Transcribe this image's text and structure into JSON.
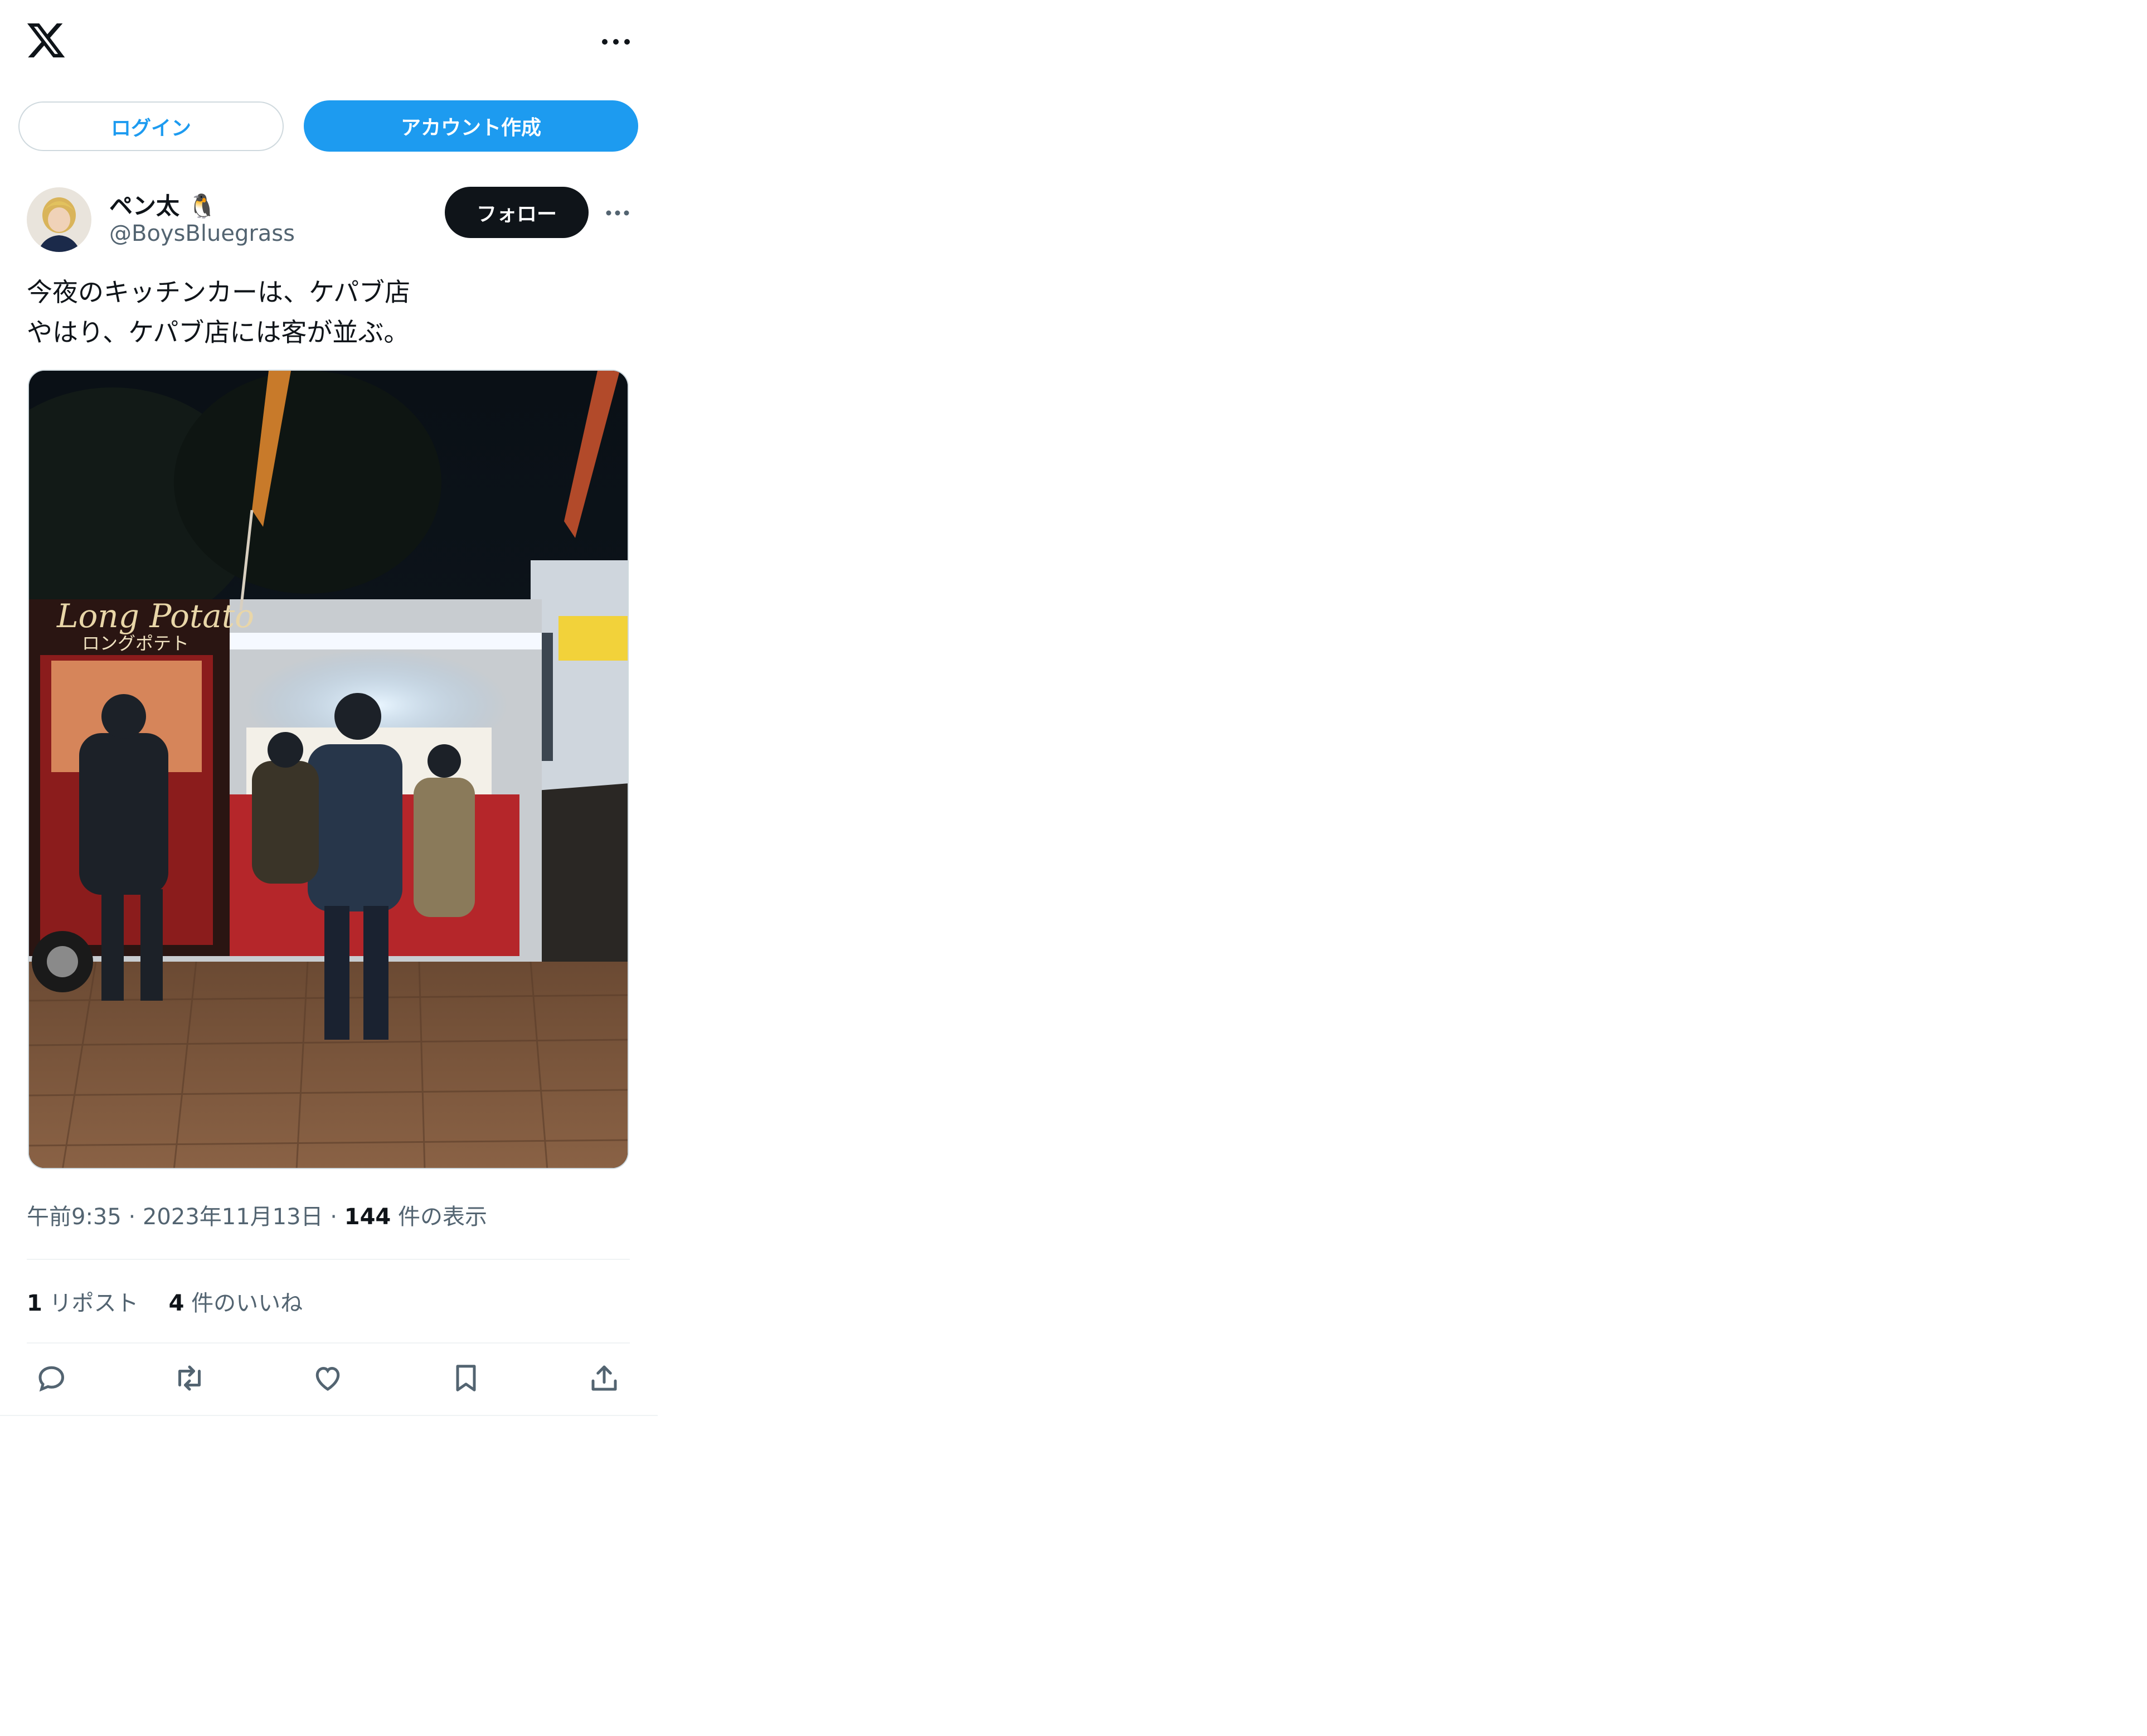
{
  "header": {
    "logo_icon": "x-logo-icon",
    "more_icon": "more-horizontal-icon"
  },
  "auth": {
    "login_label": "ログイン",
    "signup_label": "アカウント作成"
  },
  "author": {
    "name": "ペン太 🐧",
    "handle": "@BoysBluegrass",
    "follow_label": "フォロー"
  },
  "tweet": {
    "text": "今夜のキッチンカーは、ケパブ店\nやはり、ケパブ店には客が並ぶ。",
    "media_sign_en": "Long Potato",
    "media_sign_jp": "ロングポテト"
  },
  "meta": {
    "time": "午前9:35",
    "date": "2023年11月13日",
    "views_count": "144",
    "views_label": "件の表示"
  },
  "stats": {
    "reposts_count": "1",
    "reposts_label": "リポスト",
    "likes_count": "4",
    "likes_label": "件のいいね"
  },
  "actions": [
    "reply-icon",
    "repost-icon",
    "like-icon",
    "bookmark-icon",
    "share-icon"
  ],
  "colors": {
    "accent": "#1d9bf0",
    "text": "#0f1419",
    "secondary": "#536471",
    "border": "#cfd9de"
  }
}
